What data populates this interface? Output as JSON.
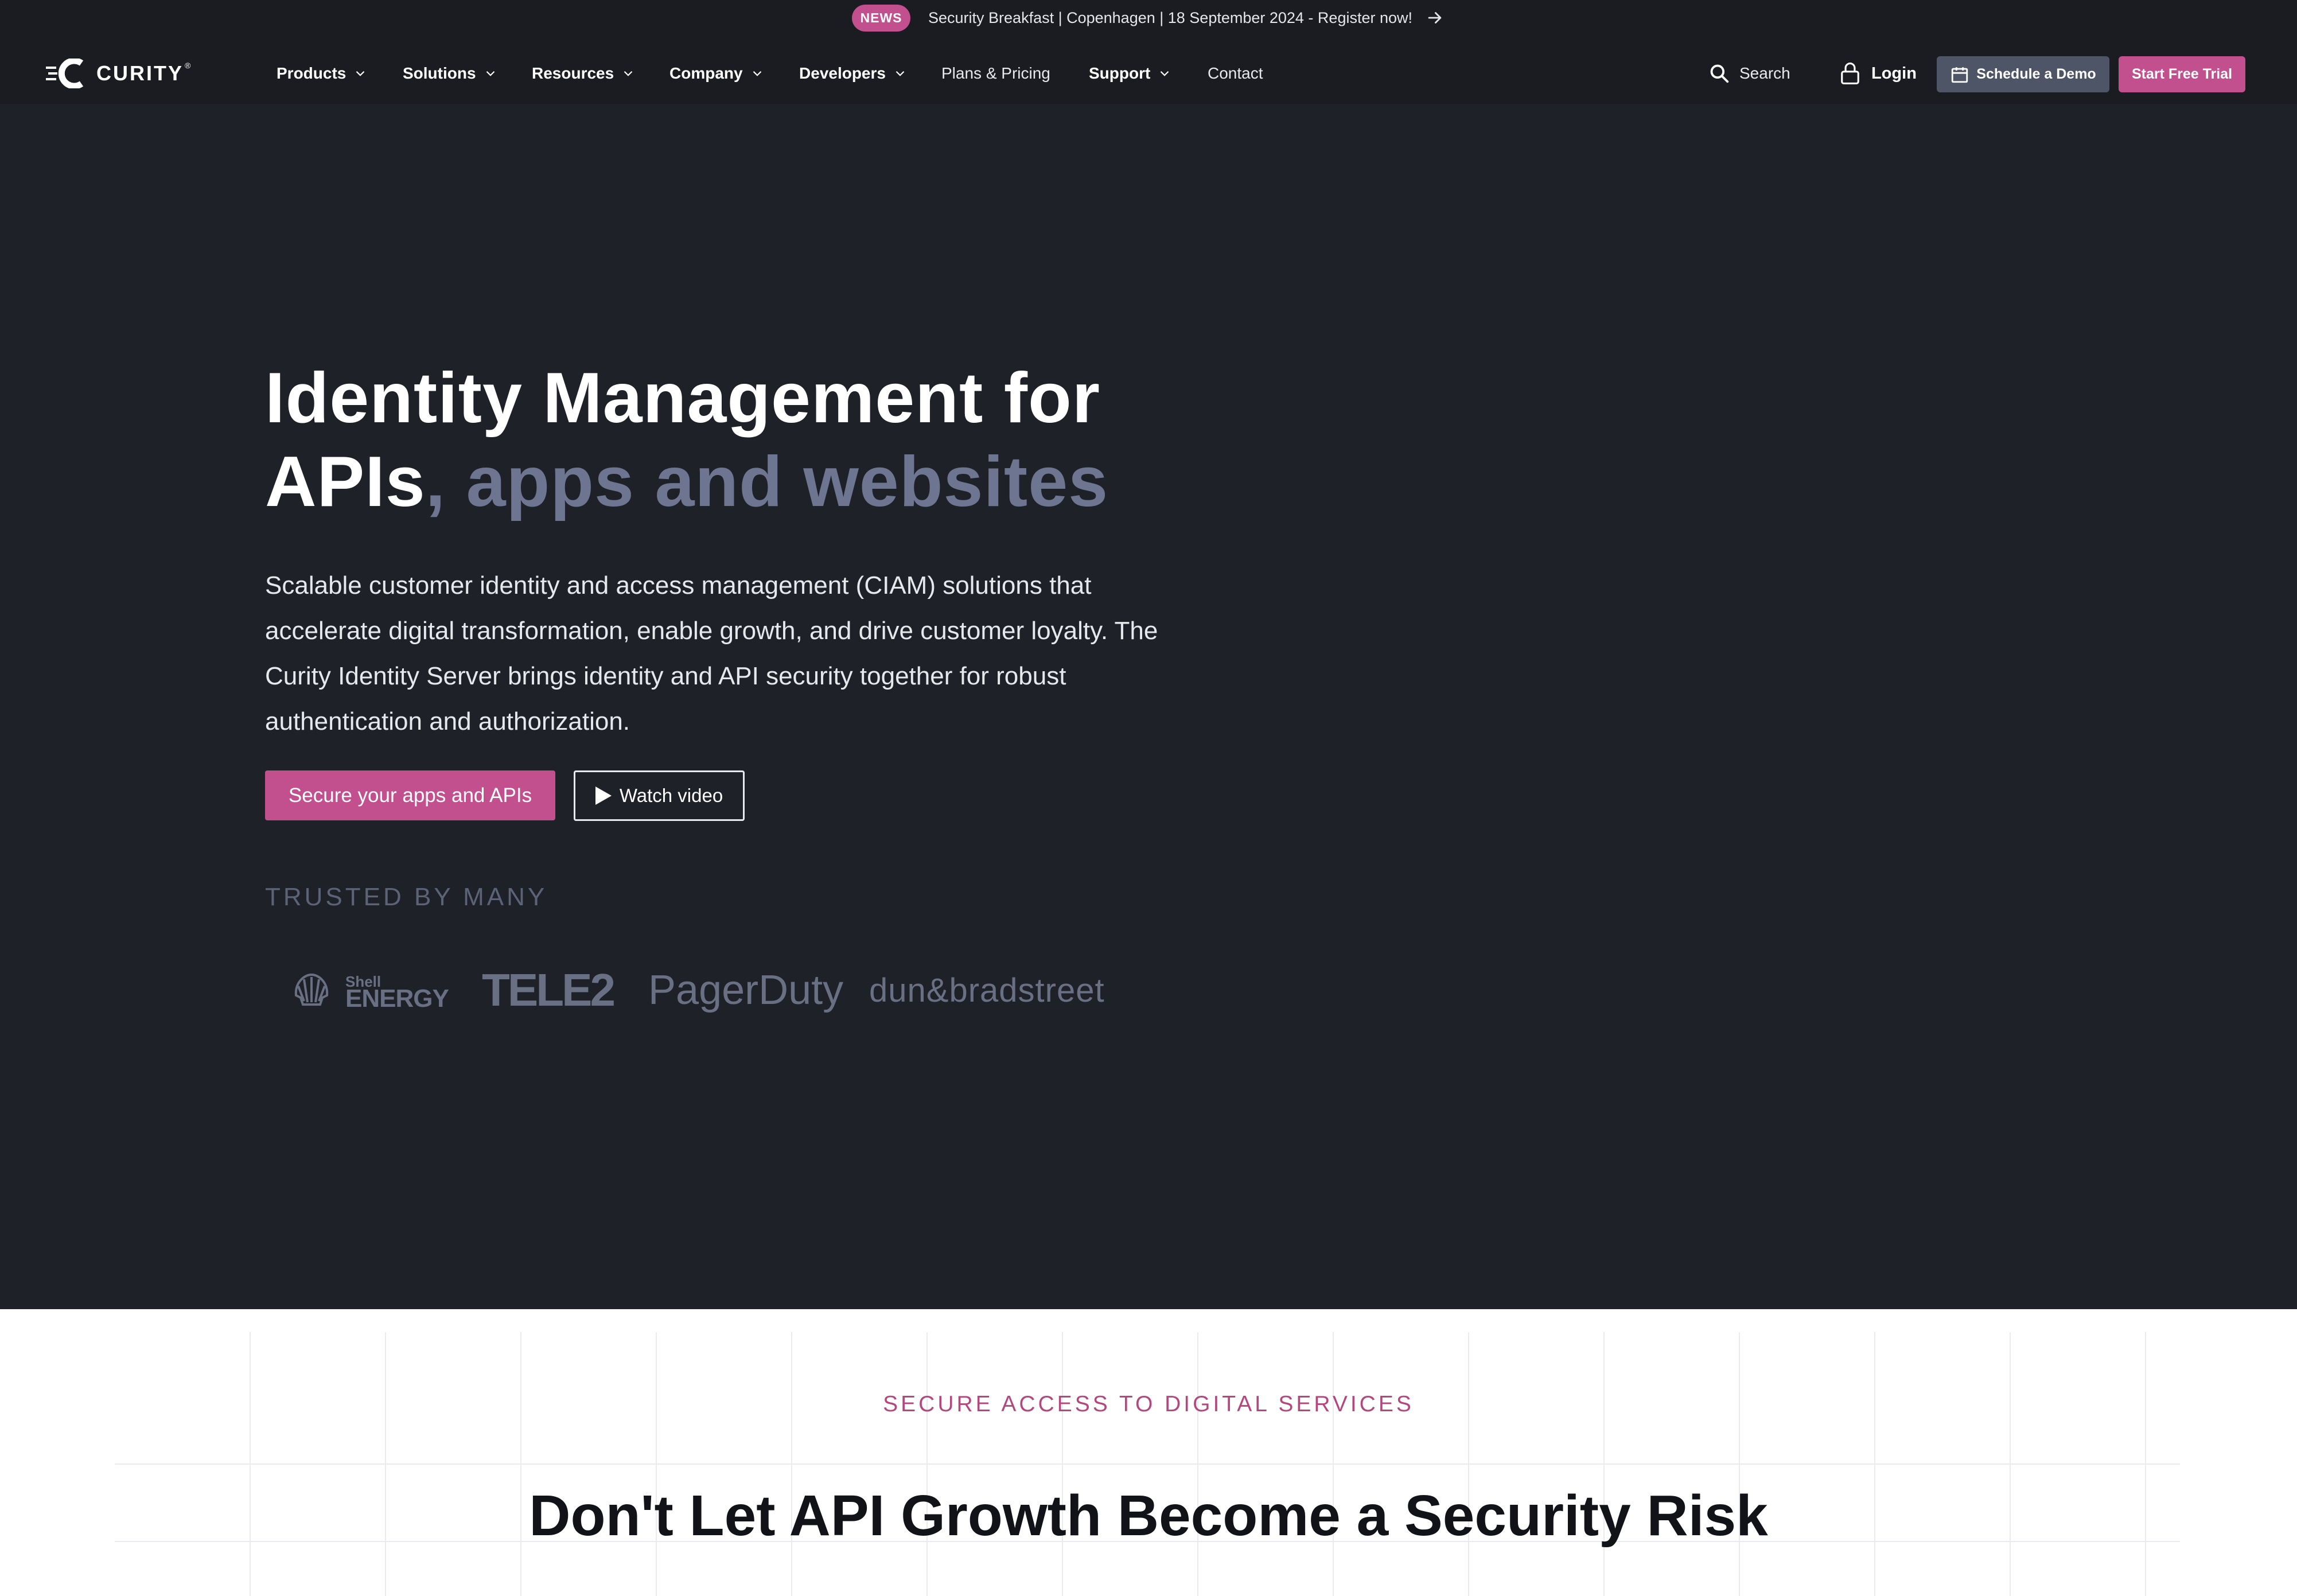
{
  "announcement": {
    "badge": "NEWS",
    "text": "Security Breakfast | Copenhagen | 18 September 2024 - Register now!",
    "arrow_icon": "arrow-right-icon"
  },
  "header": {
    "logo_text": "CURITY",
    "logo_mark": "®",
    "nav": [
      {
        "label": "Products",
        "has_dropdown": true
      },
      {
        "label": "Solutions",
        "has_dropdown": true
      },
      {
        "label": "Resources",
        "has_dropdown": true
      },
      {
        "label": "Company",
        "has_dropdown": true
      },
      {
        "label": "Developers",
        "has_dropdown": true
      },
      {
        "label": "Plans & Pricing",
        "has_dropdown": false
      },
      {
        "label": "Support",
        "has_dropdown": true
      },
      {
        "label": "Contact",
        "has_dropdown": false
      }
    ],
    "search_label": "Search",
    "login_label": "Login",
    "demo_label": "Schedule a Demo",
    "trial_label": "Start Free Trial"
  },
  "hero": {
    "title_main": "Identity Management for APIs",
    "title_accent": ", apps and websites",
    "description": "Scalable customer identity and access management (CIAM) solutions that accelerate digital transformation, enable growth, and drive customer loyalty. The Curity Identity Server brings identity and API security together for robust authentication and authorization.",
    "primary_cta": "Secure your apps and APIs",
    "video_cta": "Watch video",
    "trusted_label": "TRUSTED BY MANY",
    "brands": {
      "shell_small": "Shell",
      "shell_big": "ENERGY",
      "tele2": "TELE2",
      "pagerduty": "PagerDuty",
      "dnb": "dun&bradstreet"
    }
  },
  "section": {
    "eyebrow": "SECURE ACCESS TO DIGITAL SERVICES",
    "title": "Don't Let API Growth Become a Security Risk"
  },
  "colors": {
    "accent": "#c2508f",
    "header_bg": "#1a1c22",
    "hero_bg": "#1f2129",
    "muted_title": "#6d7590",
    "demo_button": "#4d5567"
  }
}
